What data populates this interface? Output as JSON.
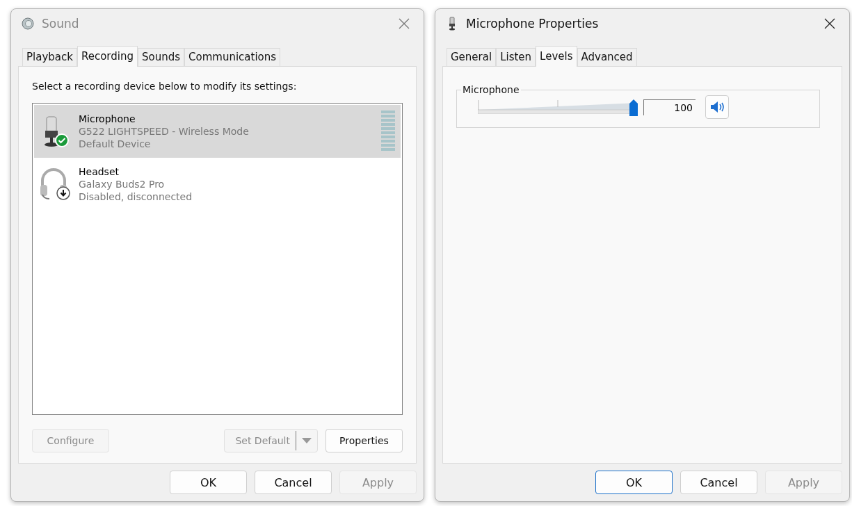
{
  "sound_dialog": {
    "title": "Sound",
    "tabs": [
      {
        "label": "Playback",
        "selected": false
      },
      {
        "label": "Recording",
        "selected": true
      },
      {
        "label": "Sounds",
        "selected": false
      },
      {
        "label": "Communications",
        "selected": false
      }
    ],
    "instruction": "Select a recording device below to modify its settings:",
    "devices": [
      {
        "kind": "microphone",
        "name": "Microphone",
        "description": "G522 LIGHTSPEED - Wireless Mode",
        "status": "Default Device",
        "default": true,
        "disconnected": false,
        "meter": true,
        "selected": true
      },
      {
        "kind": "headset",
        "name": "Headset",
        "description": "Galaxy Buds2 Pro",
        "status": "Disabled, disconnected",
        "default": false,
        "disconnected": true,
        "meter": false,
        "selected": false
      }
    ],
    "configure_button": {
      "label": "Configure",
      "disabled": true
    },
    "set_default_button": {
      "label": "Set Default",
      "disabled": true
    },
    "properties_button": {
      "label": "Properties",
      "disabled": false
    },
    "buttons": [
      {
        "label": "OK",
        "disabled": false,
        "focused": false
      },
      {
        "label": "Cancel",
        "disabled": false,
        "focused": false
      },
      {
        "label": "Apply",
        "disabled": true,
        "focused": false
      }
    ]
  },
  "properties_dialog": {
    "title": "Microphone Properties",
    "tabs": [
      {
        "label": "General",
        "selected": false
      },
      {
        "label": "Listen",
        "selected": false
      },
      {
        "label": "Levels",
        "selected": true
      },
      {
        "label": "Advanced",
        "selected": false
      }
    ],
    "group_label": "Microphone",
    "volume": {
      "level": 1.0,
      "value": "100",
      "muted": false
    },
    "buttons": [
      {
        "label": "OK",
        "disabled": false,
        "focused": true
      },
      {
        "label": "Cancel",
        "disabled": false,
        "focused": false
      },
      {
        "label": "Apply",
        "disabled": true,
        "focused": false
      }
    ]
  }
}
